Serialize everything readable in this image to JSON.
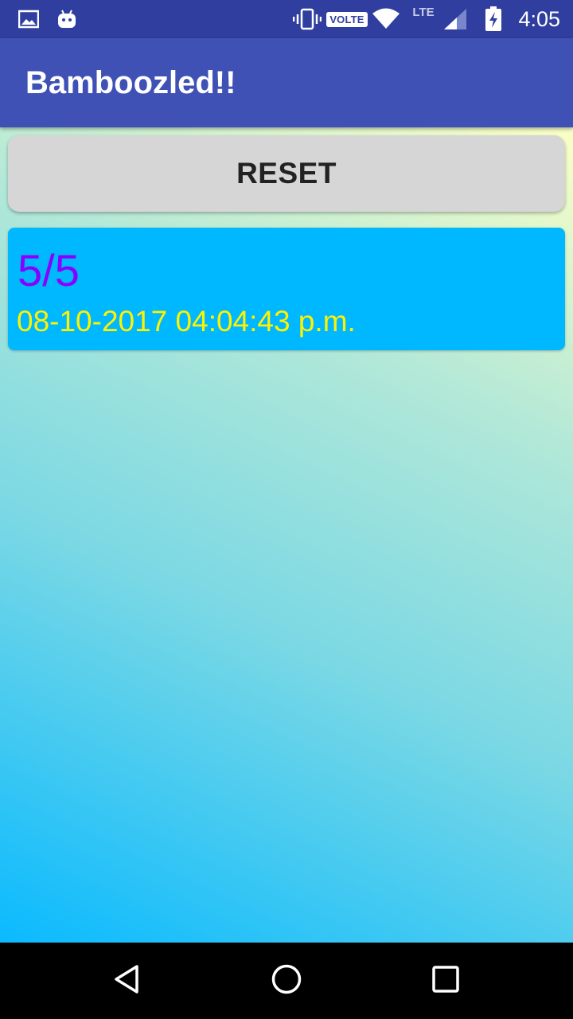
{
  "status_bar": {
    "time": "4:05",
    "volte_label": "VOLTE",
    "lte_label": "LTE",
    "icons": [
      "image-icon",
      "android-icon",
      "vibrate-icon",
      "volte-icon",
      "wifi-icon",
      "lte-icon",
      "signal-icon",
      "battery-charging-icon"
    ]
  },
  "app_bar": {
    "title": "Bamboozled!!"
  },
  "main": {
    "reset_label": "RESET",
    "score_card": {
      "score": "5/5",
      "timestamp": "08-10-2017 04:04:43 p.m."
    }
  },
  "nav_bar": {
    "icons": [
      "back-icon",
      "home-icon",
      "recents-icon"
    ]
  },
  "colors": {
    "status_bar": "#303f9f",
    "app_bar": "#3f51b5",
    "score_card": "#00b8ff",
    "score_text": "#8a00ff",
    "timestamp_text": "#fff200"
  }
}
